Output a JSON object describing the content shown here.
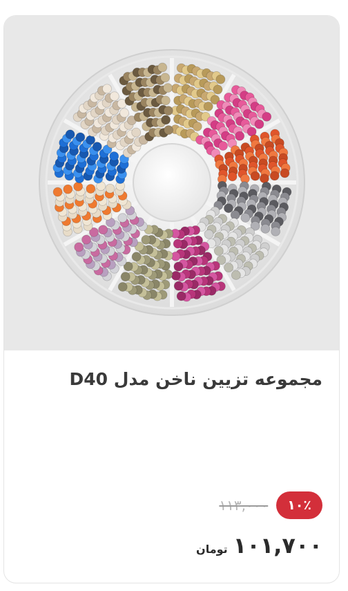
{
  "product": {
    "title": "مجموعه تزیین ناخن مدل D40",
    "image_alt": "nail decoration wheel with colored studs",
    "discount_badge": "۱۰٪",
    "old_price": "۱۱۳,۰۰۰",
    "final_price": "۱۰۱,۷۰۰",
    "currency": "تومان"
  },
  "colors": {
    "badge": "#d32f3a",
    "image_background": "#e8e8e8",
    "title": "#3a3a3a",
    "old_price": "#b5b5b5",
    "final_price": "#2b2b2b"
  }
}
